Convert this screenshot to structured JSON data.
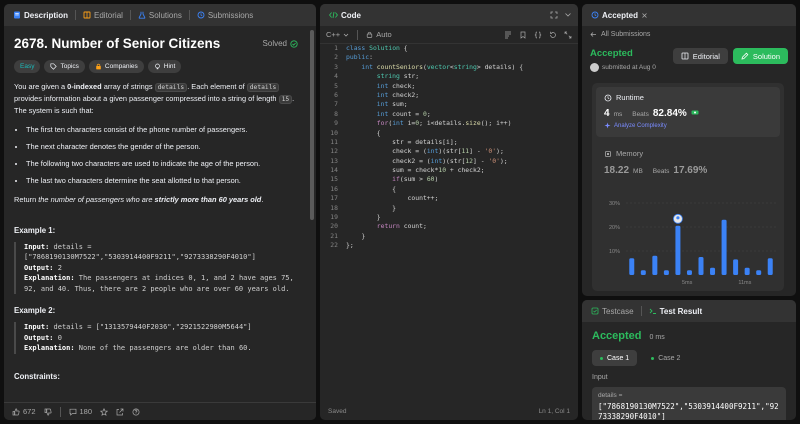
{
  "left": {
    "tabs": [
      {
        "label": "Description"
      },
      {
        "label": "Editorial"
      },
      {
        "label": "Solutions"
      },
      {
        "label": "Submissions"
      }
    ],
    "title": "2678. Number of Senior Citizens",
    "solved_label": "Solved",
    "chips": [
      "Easy",
      "Topics",
      "Companies",
      "Hint"
    ],
    "desc": {
      "p1_a": "You are given a ",
      "p1_b": "0-indexed",
      "p1_c": " array of strings ",
      "p1_code1": "details",
      "p1_d": ". Each element of ",
      "p1_code2": "details",
      "p1_e": " provides information about a given passenger compressed into a string of length ",
      "p1_code3": "15",
      "p1_f": ". The system is such that:"
    },
    "bullets": [
      "The first ten characters consist of the phone number of passengers.",
      "The next character denotes the gender of the person.",
      "The following two characters are used to indicate the age of the person.",
      "The last two characters determine the seat allotted to that person."
    ],
    "return_a": "Return ",
    "return_b": "the number of passengers who are ",
    "return_c": "strictly more than 60 years old",
    "return_d": ".",
    "examples": [
      {
        "title": "Example 1:",
        "input_lbl": "Input:",
        "input": " details = [\"7868190130M7522\",\"5303914400F9211\",\"9273338290F4010\"]",
        "output_lbl": "Output:",
        "output": " 2",
        "expl_lbl": "Explanation:",
        "expl": " The passengers at indices 0, 1, and 2 have ages 75, 92, and 40. Thus, there are 2 people who are over 60 years old."
      },
      {
        "title": "Example 2:",
        "input_lbl": "Input:",
        "input": " details = [\"1313579440F2036\",\"2921522980M5644\"]",
        "output_lbl": "Output:",
        "output": " 0",
        "expl_lbl": "Explanation:",
        "expl": " None of the passengers are older than 60."
      }
    ],
    "constraints_label": "Constraints:",
    "footer": {
      "likes": "672",
      "comments": "180"
    }
  },
  "mid": {
    "tab": "Code",
    "lang": "C++",
    "mode": "Auto",
    "status_left": "Saved",
    "status_right": "Ln 1, Col 1"
  },
  "rtop": {
    "tab": "Accepted",
    "back_label": "All Submissions",
    "accepted": "Accepted",
    "submitted": "submitted at Aug 0",
    "editorial_btn": "Editorial",
    "solution_btn": "Solution",
    "runtime_label": "Runtime",
    "runtime_value": "4",
    "runtime_unit": "ms",
    "beats_label": "Beats",
    "runtime_beats": "82.84%",
    "analyze": "Analyze Complexity",
    "memory_label": "Memory",
    "memory_value": "18.22",
    "memory_unit": "MB",
    "memory_beats": "17.69%"
  },
  "chart_data": {
    "type": "bar",
    "ylim": [
      0,
      30
    ],
    "y_ticks": [
      "30%",
      "20%",
      "10%"
    ],
    "x_tick_labels": [
      "5ms",
      "11ms"
    ],
    "values": [
      7,
      2,
      8,
      2,
      20.5,
      2,
      7.5,
      3,
      23,
      6.5,
      3,
      2,
      7
    ],
    "highlight_index": 4,
    "accent": "#3b82f6"
  },
  "rbot": {
    "tab1": "Testcase",
    "tab2": "Test Result",
    "accepted": "Accepted",
    "time": "0 ms",
    "cases": [
      "Case 1",
      "Case 2"
    ],
    "input_label": "Input",
    "var_name": "details =",
    "var_value": "[\"7868190130M7522\",\"5303914400F9211\",\"9273338290F4010\"]"
  }
}
